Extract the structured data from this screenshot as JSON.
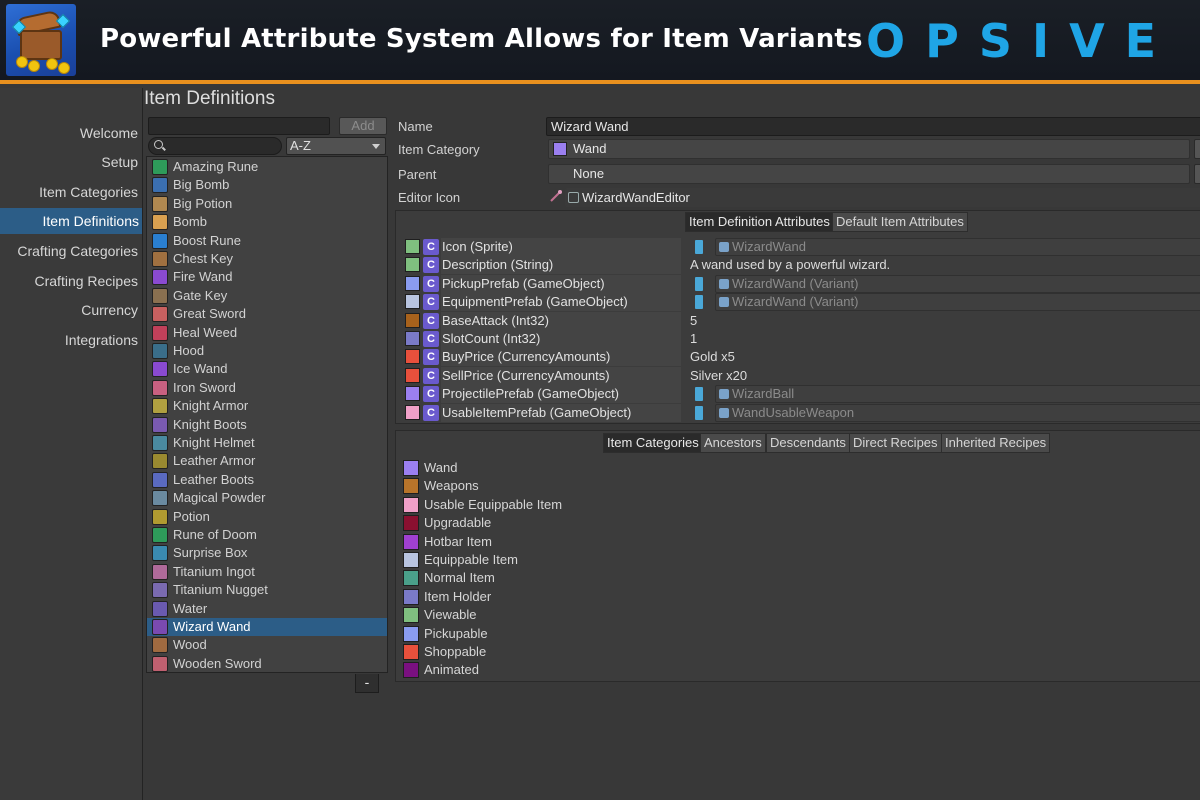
{
  "banner": {
    "title": "Powerful Attribute System Allows for Item Variants",
    "brand": "OPSIVE"
  },
  "nav": {
    "items": [
      "Welcome",
      "Setup",
      "Item Categories",
      "Item Definitions",
      "Crafting Categories",
      "Crafting Recipes",
      "Currency",
      "Integrations"
    ],
    "active": "Item Definitions"
  },
  "section_title": "Item Definitions",
  "list_controls": {
    "add_label": "Add",
    "sort_value": "A-Z",
    "remove_label": "-"
  },
  "items": [
    {
      "name": "Amazing Rune",
      "color": "#2e9b5a"
    },
    {
      "name": "Big Bomb",
      "color": "#3b6fb0"
    },
    {
      "name": "Big Potion",
      "color": "#b08850"
    },
    {
      "name": "Bomb",
      "color": "#d9a050"
    },
    {
      "name": "Boost Rune",
      "color": "#2a7fd0"
    },
    {
      "name": "Chest Key",
      "color": "#a07040"
    },
    {
      "name": "Fire Wand",
      "color": "#8a4ad0"
    },
    {
      "name": "Gate Key",
      "color": "#8a7050"
    },
    {
      "name": "Great Sword",
      "color": "#c86060"
    },
    {
      "name": "Heal Weed",
      "color": "#c0405a"
    },
    {
      "name": "Hood",
      "color": "#3a6e8a"
    },
    {
      "name": "Ice Wand",
      "color": "#8a4ad0"
    },
    {
      "name": "Iron Sword",
      "color": "#c86080"
    },
    {
      "name": "Knight Armor",
      "color": "#b0a040"
    },
    {
      "name": "Knight Boots",
      "color": "#7a5ab0"
    },
    {
      "name": "Knight Helmet",
      "color": "#4a8aa0"
    },
    {
      "name": "Leather Armor",
      "color": "#9a8a30"
    },
    {
      "name": "Leather Boots",
      "color": "#5a6ac0"
    },
    {
      "name": "Magical Powder",
      "color": "#6a8aa0"
    },
    {
      "name": "Potion",
      "color": "#b09a30"
    },
    {
      "name": "Rune of Doom",
      "color": "#2e9b5a"
    },
    {
      "name": "Surprise Box",
      "color": "#3a8ab0"
    },
    {
      "name": "Titanium Ingot",
      "color": "#b06a9a"
    },
    {
      "name": "Titanium Nugget",
      "color": "#7a6ab0"
    },
    {
      "name": "Water",
      "color": "#6a5ab0"
    },
    {
      "name": "Wizard Wand",
      "color": "#7a4ab0",
      "selected": true
    },
    {
      "name": "Wood",
      "color": "#a06a40"
    },
    {
      "name": "Wooden Sword",
      "color": "#c06070"
    }
  ],
  "properties": {
    "name_label": "Name",
    "name_value": "Wizard Wand",
    "category_label": "Item Category",
    "category_value": "Wand",
    "category_color": "#9b7ff0",
    "parent_label": "Parent",
    "parent_value": "None",
    "icon_label": "Editor Icon",
    "icon_value": "WizardWandEditor"
  },
  "attr_tabs": [
    "Item Definition Attributes",
    "Default Item Attributes"
  ],
  "attributes": [
    {
      "name": "Icon (Sprite)",
      "color": "#7fbf7f",
      "value": "WizardWand",
      "kind": "object"
    },
    {
      "name": "Description (String)",
      "color": "#7fbf7f",
      "value": "A wand used by a powerful wizard.",
      "kind": "text"
    },
    {
      "name": "PickupPrefab (GameObject)",
      "color": "#8a9cf0",
      "value": "WizardWand (Variant)",
      "kind": "object"
    },
    {
      "name": "EquipmentPrefab (GameObject)",
      "color": "#b8c4e0",
      "value": "WizardWand (Variant)",
      "kind": "object"
    },
    {
      "name": "BaseAttack (Int32)",
      "color": "#a8621c",
      "value": "5",
      "kind": "text"
    },
    {
      "name": "SlotCount (Int32)",
      "color": "#7a7ac8",
      "value": "1",
      "kind": "text"
    },
    {
      "name": "BuyPrice (CurrencyAmounts)",
      "color": "#e8503c",
      "value": "Gold x5",
      "kind": "text"
    },
    {
      "name": "SellPrice (CurrencyAmounts)",
      "color": "#e8503c",
      "value": "Silver x20",
      "kind": "text"
    },
    {
      "name": "ProjectilePrefab (GameObject)",
      "color": "#9b7ff0",
      "value": "WizardBall",
      "kind": "object"
    },
    {
      "name": "UsableItemPrefab (GameObject)",
      "color": "#f0a0c8",
      "value": "WandUsableWeapon",
      "kind": "object"
    }
  ],
  "cat_tabs": [
    "Item Categories",
    "Ancestors",
    "Descendants",
    "Direct Recipes",
    "Inherited Recipes"
  ],
  "categories": [
    {
      "name": "Wand",
      "color": "#9b7ff0"
    },
    {
      "name": "Weapons",
      "color": "#b8742a"
    },
    {
      "name": "Usable Equippable Item",
      "color": "#f0a0c8"
    },
    {
      "name": "Upgradable",
      "color": "#8a1030"
    },
    {
      "name": "Hotbar Item",
      "color": "#a040d0"
    },
    {
      "name": "Equippable Item",
      "color": "#b8c4e0"
    },
    {
      "name": "Normal Item",
      "color": "#4aa08a"
    },
    {
      "name": "Item Holder",
      "color": "#7a7ac8"
    },
    {
      "name": "Viewable",
      "color": "#7fbf7f"
    },
    {
      "name": "Pickupable",
      "color": "#8a9cf0"
    },
    {
      "name": "Shoppable",
      "color": "#e8503c"
    },
    {
      "name": "Animated",
      "color": "#7a1080"
    }
  ]
}
